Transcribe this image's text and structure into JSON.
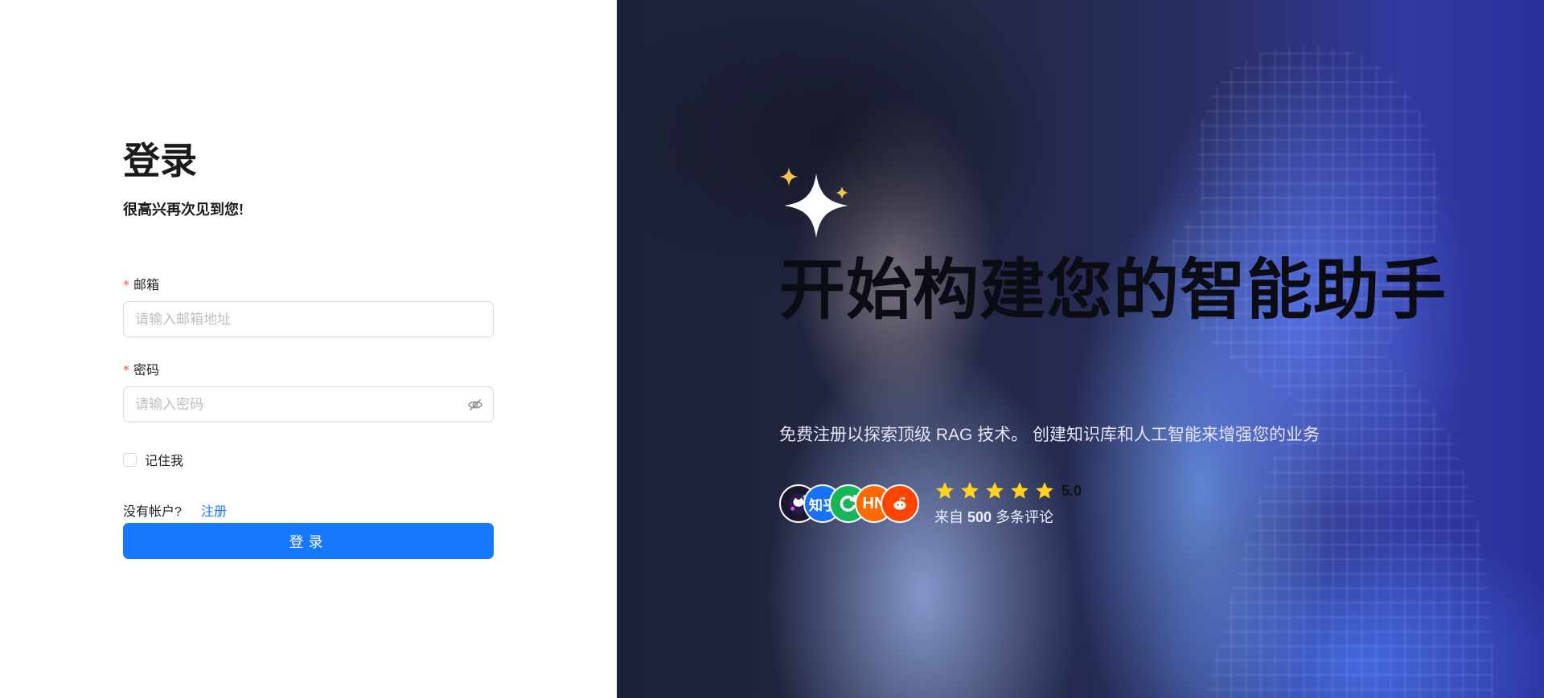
{
  "login": {
    "title": "登录",
    "subtitle": "很高兴再次见到您!",
    "email": {
      "label": "邮箱",
      "required_mark": "*",
      "placeholder": "请输入邮箱地址"
    },
    "password": {
      "label": "密码",
      "required_mark": "*",
      "placeholder": "请输入密码"
    },
    "remember_label": "记住我",
    "no_account_text": "没有帐户?",
    "register_link": "注册",
    "submit_label": "登录"
  },
  "hero": {
    "title": "开始构建您的智能助手",
    "description": "免费注册以探索顶级 RAG 技术。 创建知识库和人工智能来增强您的业务",
    "avatars": [
      {
        "name": "github-avatar",
        "glyph": "",
        "color": "#1b1630"
      },
      {
        "name": "zhihu-avatar",
        "glyph": "知乎",
        "color": "#1772f6"
      },
      {
        "name": "wechat-avatar",
        "glyph": "",
        "color": "#17b45a"
      },
      {
        "name": "hackernews-avatar",
        "glyph": "HN",
        "color": "#ff6a00"
      },
      {
        "name": "reddit-avatar",
        "glyph": "",
        "color": "#ff4500"
      }
    ],
    "star_count": 5,
    "rating": "5.0",
    "reviews_prefix": "来自",
    "reviews_count": "500",
    "reviews_suffix": "多条评论",
    "colors": {
      "star": "#ffd21e",
      "sparkle_main": "#ffffff",
      "sparkle_small": "#f5c24a"
    }
  },
  "colors": {
    "primary": "#1677ff",
    "required": "#ff4d4f",
    "border": "#d9d9d9",
    "placeholder": "#bfbfbf"
  }
}
